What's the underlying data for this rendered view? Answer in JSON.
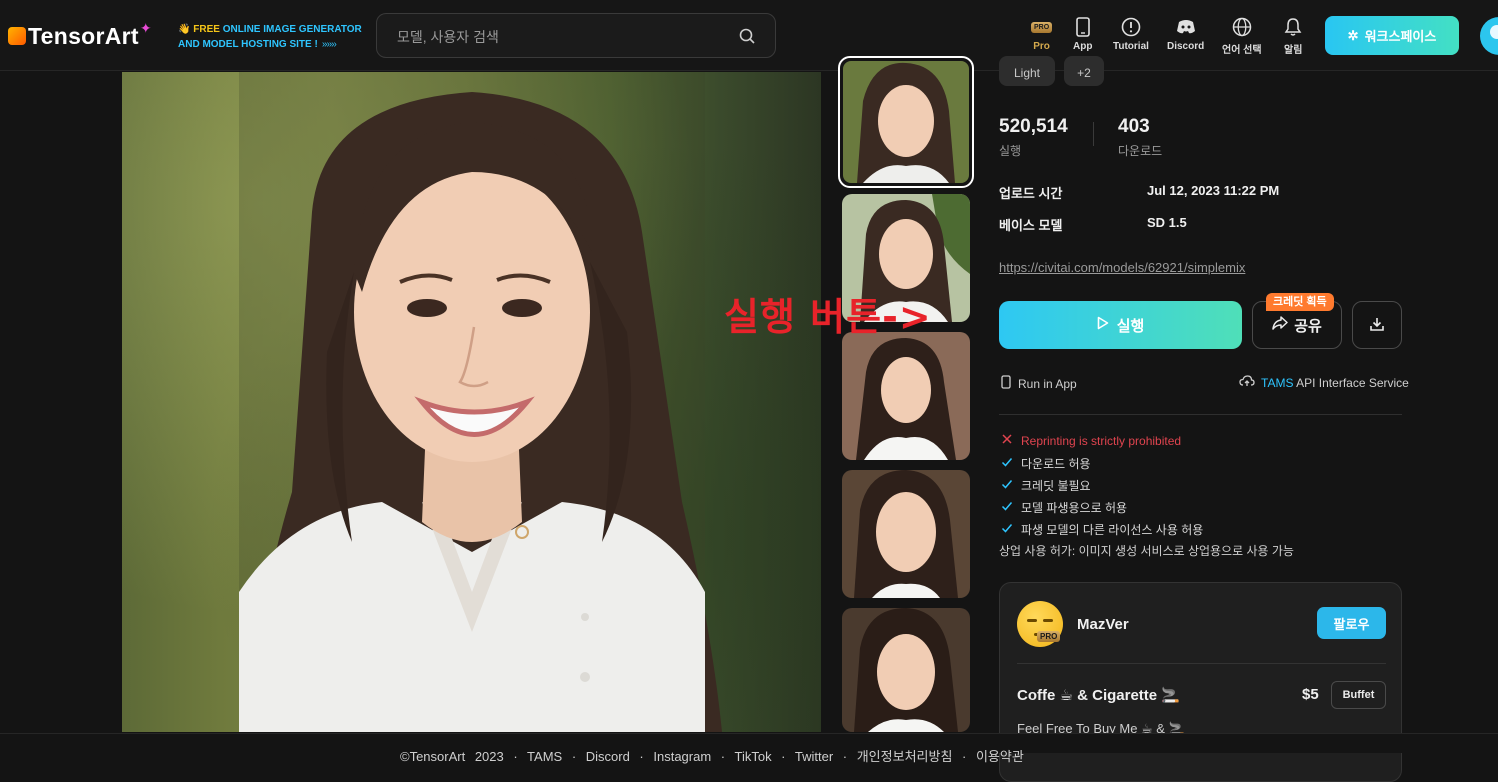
{
  "header": {
    "logo_text": "TensorArt",
    "promo_line1_highlight": "FREE",
    "promo_line1_rest": "ONLINE IMAGE GENERATOR",
    "promo_line2": "AND MODEL HOSTING SITE !",
    "promo_arrows": "››››››",
    "search_placeholder": "모델, 사용자 검색",
    "nav": [
      {
        "label": "Pro",
        "icon": "pro-badge-icon",
        "badge": "PRO"
      },
      {
        "label": "App",
        "icon": "mobile-icon"
      },
      {
        "label": "Tutorial",
        "icon": "info-circle-icon"
      },
      {
        "label": "Discord",
        "icon": "discord-icon"
      },
      {
        "label": "언어 선택",
        "icon": "globe-icon"
      },
      {
        "label": "알림",
        "icon": "bell-icon"
      }
    ],
    "workspace_label": "워크스페이스",
    "accent_gradient": [
      "#29c6f2",
      "#43e0c4"
    ]
  },
  "tags": [
    "Light",
    "+2"
  ],
  "stats": [
    {
      "value": "520,514",
      "label": "실행"
    },
    {
      "value": "403",
      "label": "다운로드"
    }
  ],
  "meta": [
    {
      "key": "업로드 시간",
      "value": "Jul 12, 2023 11:22 PM"
    },
    {
      "key": "베이스 모델",
      "value": "SD 1.5"
    }
  ],
  "source_link": "https://civitai.com/models/62921/simplemix",
  "actions": {
    "run_label": "실행",
    "share_label": "공유",
    "credit_badge": "크레딧 획득",
    "run_in_app": "Run in App",
    "tams_highlight": "TAMS",
    "tams_rest": "API Interface Service"
  },
  "annotation": "실행 버튼->",
  "permissions": [
    {
      "text": "Reprinting is strictly prohibited",
      "allowed": false
    },
    {
      "text": "다운로드 허용",
      "allowed": true
    },
    {
      "text": "크레딧 불필요",
      "allowed": true
    },
    {
      "text": "모델 파생용으로 허용",
      "allowed": true
    },
    {
      "text": "파생 모델의 다른 라이선스 사용 허용",
      "allowed": true
    }
  ],
  "commercial_use": "상업 사용 허가: 이미지 생성 서비스로 상업용으로 사용 가능",
  "author": {
    "name": "MazVer",
    "pro_badge": "PRO",
    "follow_label": "팔로우",
    "support_title": "Coffe ☕ & Cigarette 🚬",
    "support_price": "$5",
    "support_tier": "Buffet",
    "support_desc": "Feel Free To Buy Me ☕ & 🚬"
  },
  "footer": "©TensorArt 2023 · TAMS · Discord · Instagram · TikTok · Twitter · 개인정보처리방침 · 이용약관",
  "colors": {
    "deny": "#e0444f",
    "allow": "#2ec5ff",
    "badge": "#ff7a2e",
    "annotation": "#e8232a"
  }
}
